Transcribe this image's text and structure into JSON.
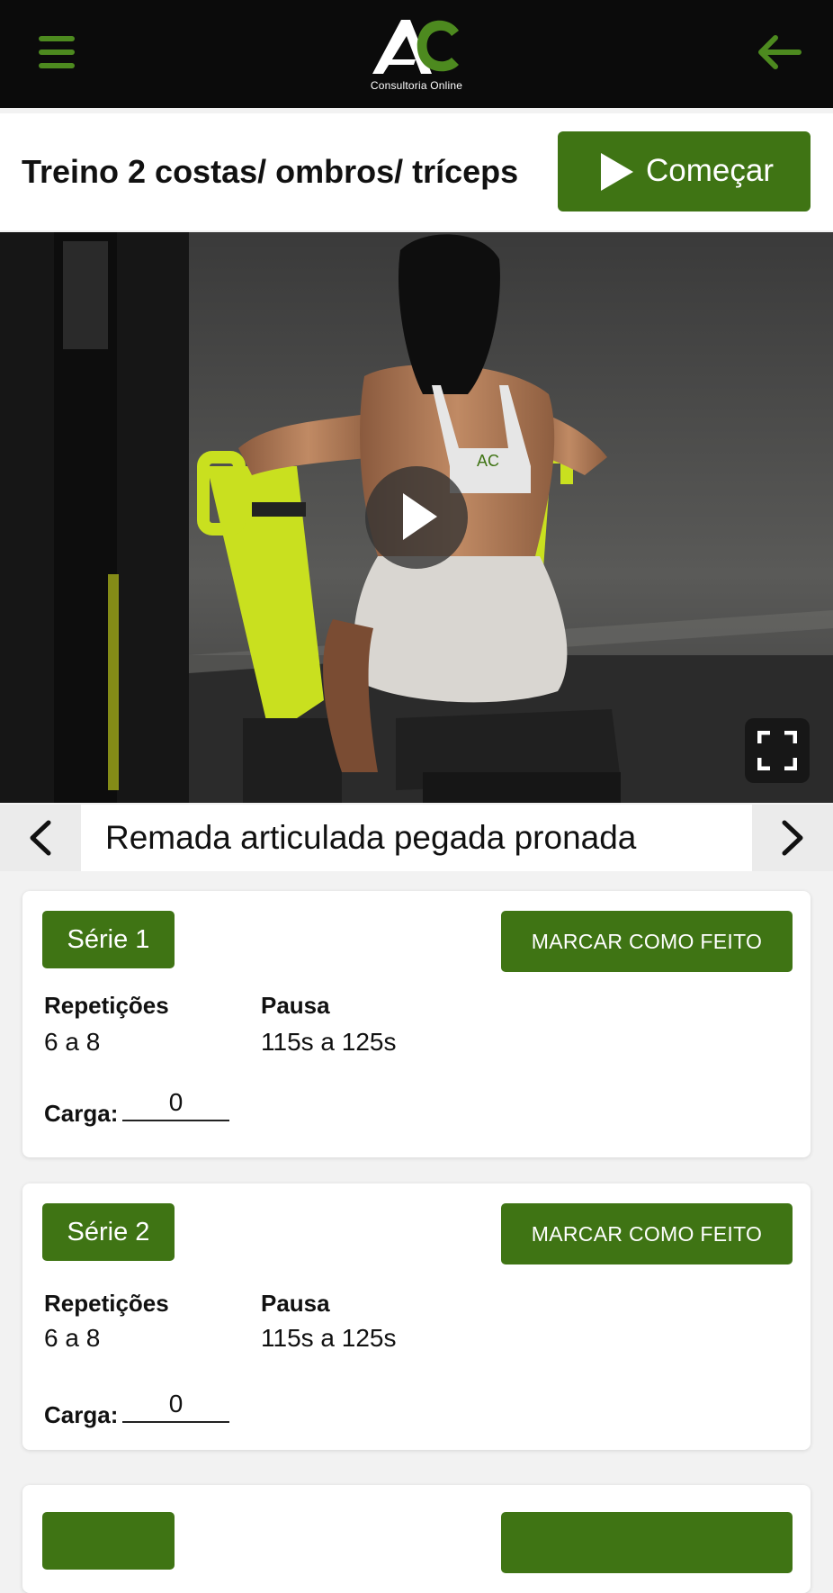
{
  "header": {
    "logo_text": "AC",
    "logo_subtitle": "Consultoria Online",
    "menu_icon": "hamburger-menu-icon",
    "back_icon": "arrow-left-icon"
  },
  "workout": {
    "title": "Treino 2 costas/ ombros/ tríceps",
    "start_label": "Começar"
  },
  "video": {
    "play_icon": "play-icon",
    "fullscreen_icon": "fullscreen-icon"
  },
  "exercise": {
    "name": "Remada articulada pegada pronada"
  },
  "series": [
    {
      "label": "Série 1",
      "done_label": "MARCAR COMO FEITO",
      "reps_label": "Repetições",
      "reps_value": "6 a 8",
      "rest_label": "Pausa",
      "rest_value": "115s a 125s",
      "load_label": "Carga:",
      "load_value": "0"
    },
    {
      "label": "Série 2",
      "done_label": "MARCAR COMO FEITO",
      "reps_label": "Repetições",
      "reps_value": "6 a 8",
      "rest_label": "Pausa",
      "rest_value": "115s a 125s",
      "load_label": "Carga:",
      "load_value": "0"
    }
  ],
  "colors": {
    "accent": "#3f7414",
    "accent_light": "#4d8a1f",
    "header_bg": "#0b0b0b",
    "machine_yellow": "#c9e01f"
  }
}
